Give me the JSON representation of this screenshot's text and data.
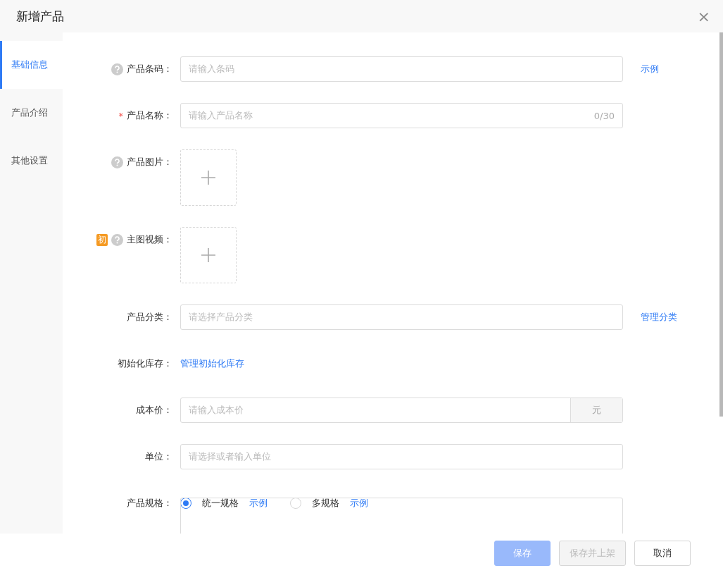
{
  "dialog": {
    "title": "新增产品",
    "close": "×"
  },
  "tabs": [
    {
      "label": "基础信息",
      "selected": true
    },
    {
      "label": "产品介绍",
      "selected": false
    },
    {
      "label": "其他设置",
      "selected": false
    }
  ],
  "fields": [
    {
      "kind": "input",
      "label": "产品条码：",
      "help": true,
      "placeholder": "请输入条码",
      "link": "示例"
    },
    {
      "kind": "input",
      "label": "产品名称：",
      "required_mark": "*",
      "placeholder": "请输入产品名称",
      "counter": "0/30"
    },
    {
      "kind": "upload",
      "label": "产品图片：",
      "help": true
    },
    {
      "kind": "upload",
      "label": "主图视频：",
      "help": true,
      "badge": "初"
    },
    {
      "kind": "input",
      "label": "产品分类：",
      "placeholder": "请选择产品分类",
      "link": "管理分类"
    },
    {
      "kind": "link",
      "label": "初始化库存：",
      "link": "管理初始化库存"
    },
    {
      "kind": "suffix",
      "label": "成本价：",
      "placeholder": "请输入成本价",
      "suffix": "元"
    },
    {
      "kind": "input",
      "label": "单位：",
      "placeholder": "请选择或者输入单位"
    },
    {
      "kind": "radio",
      "label": "产品规格：",
      "options": [
        {
          "label": "统一规格",
          "selected": true,
          "link": "示例"
        },
        {
          "label": "多规格",
          "selected": false,
          "link": "示例"
        }
      ]
    }
  ],
  "buttons": [
    {
      "label": "保存",
      "kind": "primary",
      "disabled": true
    },
    {
      "label": "保存并上架",
      "kind": "default",
      "disabled": true
    },
    {
      "label": "取消",
      "kind": "default",
      "disabled": false
    }
  ]
}
